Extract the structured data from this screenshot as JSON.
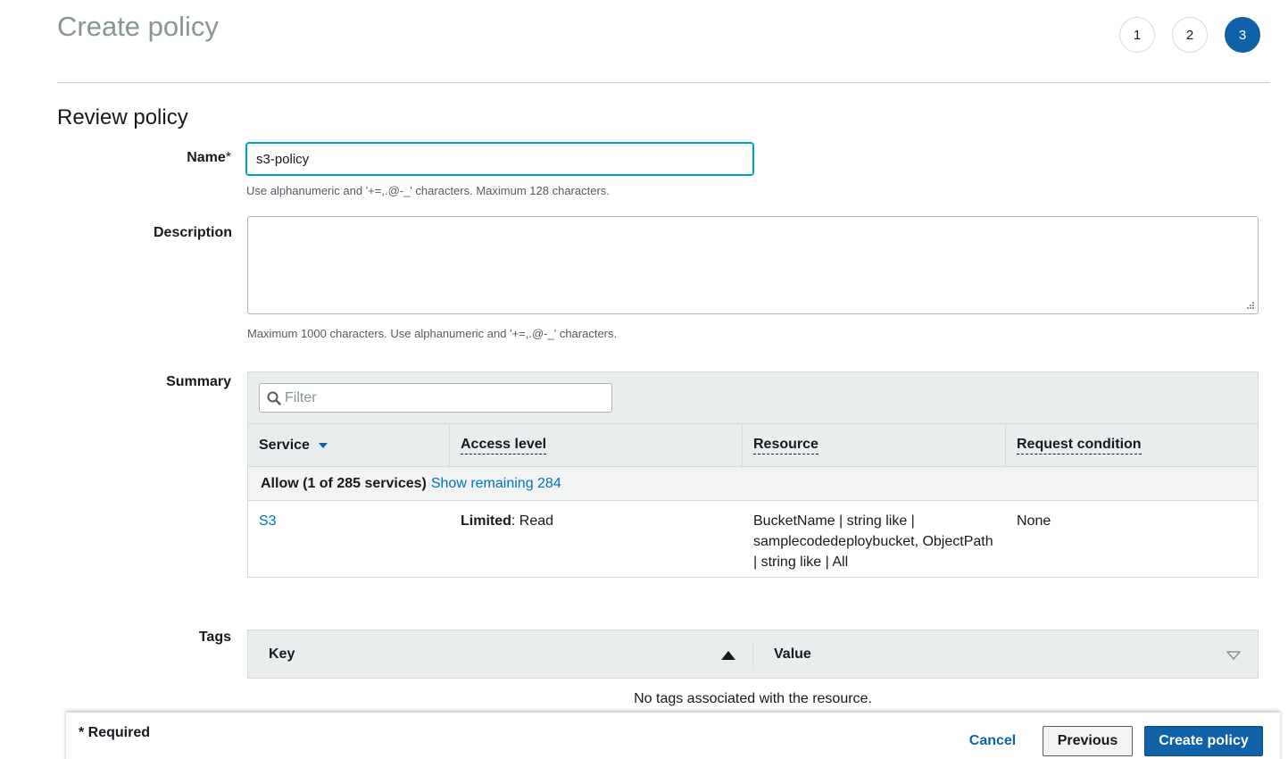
{
  "header": {
    "title": "Create policy"
  },
  "steps": [
    "1",
    "2",
    "3"
  ],
  "colors": {
    "accent": "#0f62a8",
    "link": "#0073bb",
    "focus": "#00a1c9"
  },
  "review": {
    "title": "Review policy",
    "name_label": "Name",
    "name_required_mark": "*",
    "name_value": "s3-policy",
    "name_hint": "Use alphanumeric and '+=,.@-_' characters. Maximum 128 characters.",
    "description_label": "Description",
    "description_value": "",
    "description_hint": "Maximum 1000 characters. Use alphanumeric and '+=,.@-_' characters.",
    "summary_label": "Summary"
  },
  "summary": {
    "filter_placeholder": "Filter",
    "search_icon": "search-icon",
    "columns": [
      "Service",
      "Access level",
      "Resource",
      "Request condition"
    ],
    "group": {
      "label": "Allow (1 of 285 services)",
      "link": "Show remaining 284"
    },
    "rows": [
      {
        "service": "S3",
        "access_bold": "Limited",
        "access_rest": ": Read",
        "resource": "BucketName | string like | samplecodedeploybucket, ObjectPath | string like | All",
        "condition": "None"
      }
    ]
  },
  "tags": {
    "label": "Tags",
    "columns": [
      "Key",
      "Value"
    ],
    "empty": "No tags associated with the resource."
  },
  "footer": {
    "required": "* Required",
    "cancel": "Cancel",
    "previous": "Previous",
    "create": "Create policy"
  }
}
